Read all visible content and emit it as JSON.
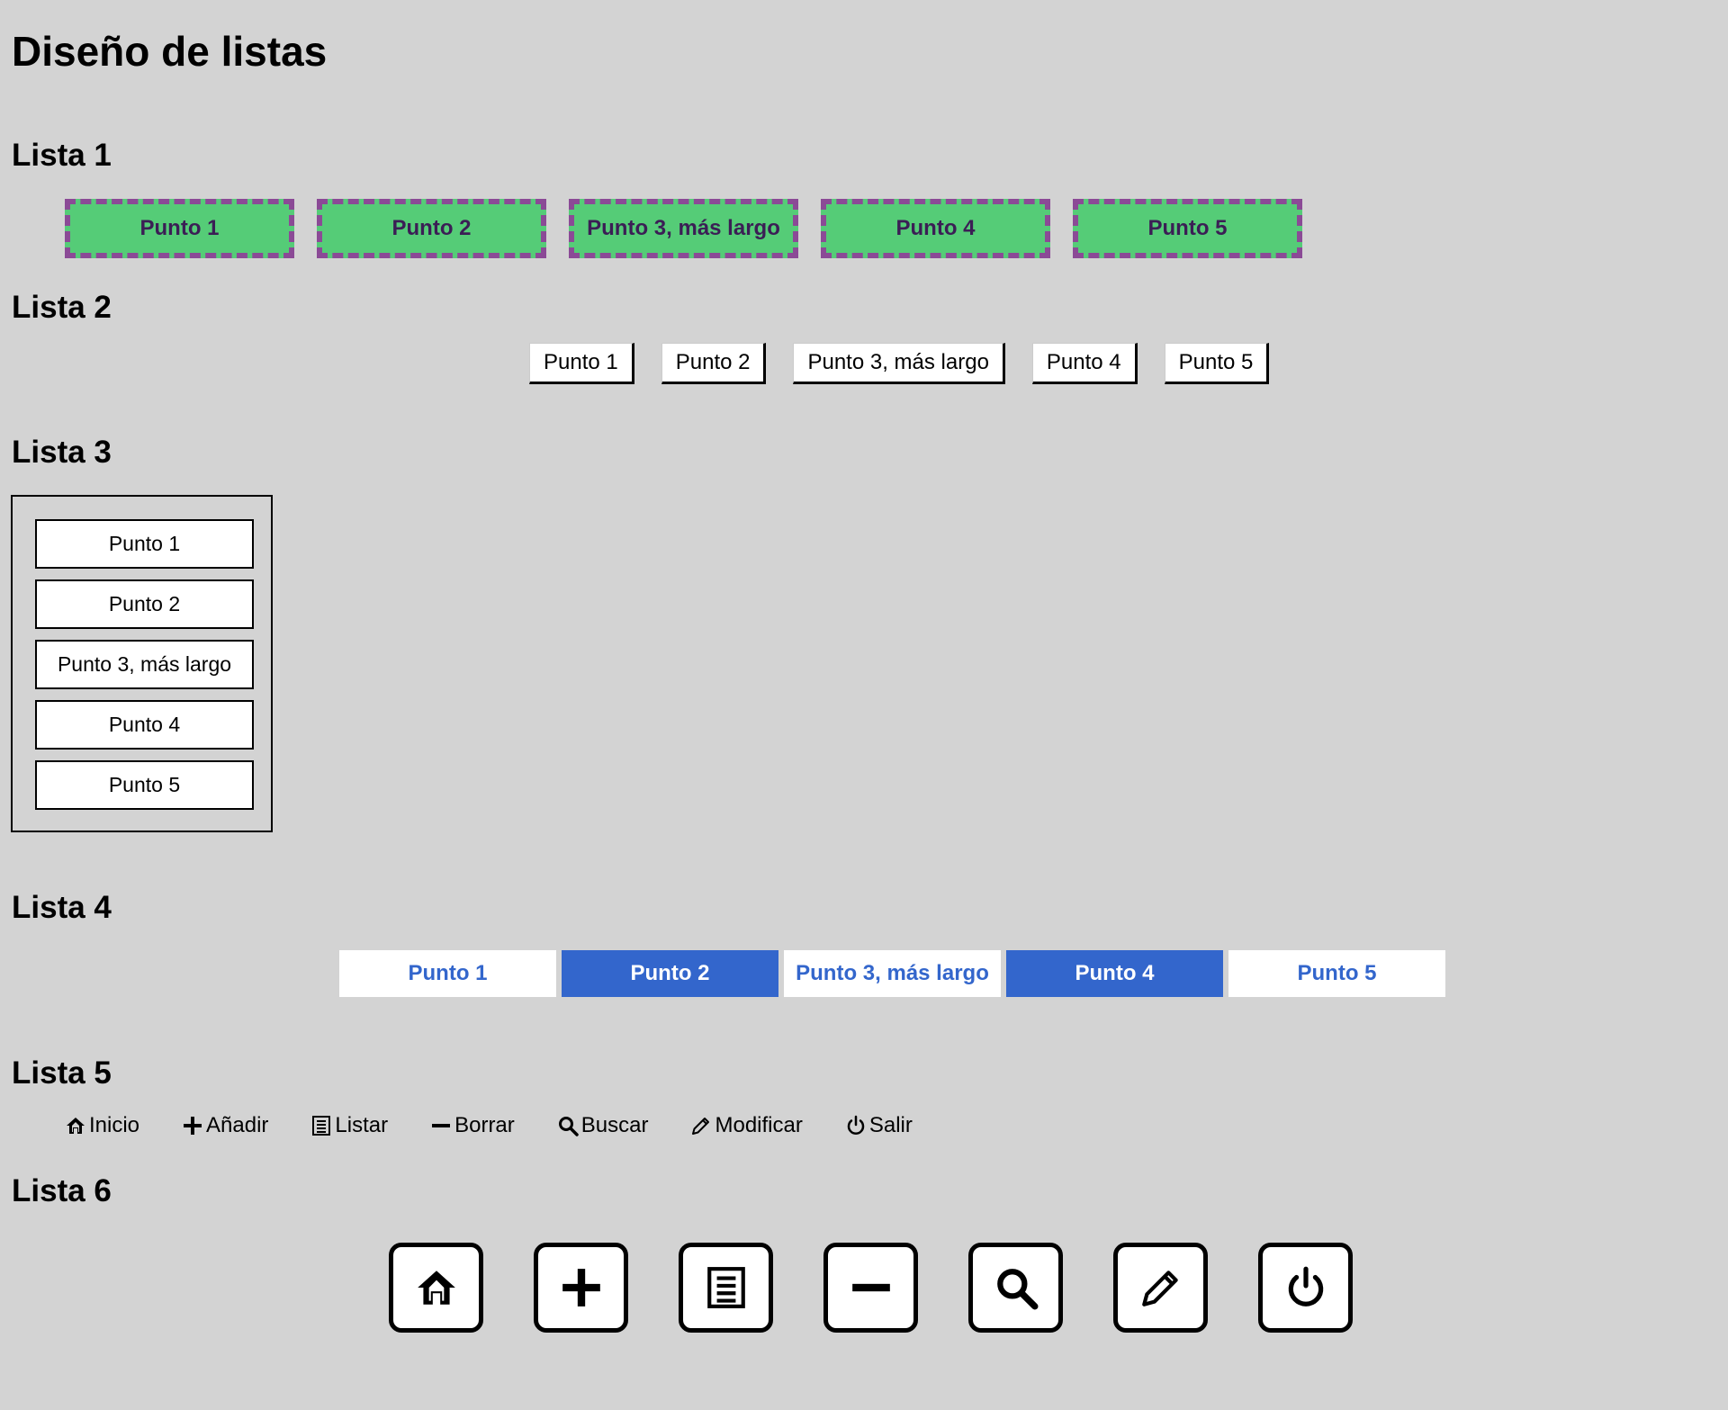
{
  "page_title": "Diseño de listas",
  "lista1": {
    "heading": "Lista 1",
    "items": [
      "Punto 1",
      "Punto 2",
      "Punto 3, más largo",
      "Punto 4",
      "Punto 5"
    ]
  },
  "lista2": {
    "heading": "Lista 2",
    "items": [
      "Punto 1",
      "Punto 2",
      "Punto 3, más largo",
      "Punto 4",
      "Punto 5"
    ]
  },
  "lista3": {
    "heading": "Lista 3",
    "items": [
      "Punto 1",
      "Punto 2",
      "Punto 3, más largo",
      "Punto 4",
      "Punto 5"
    ]
  },
  "lista4": {
    "heading": "Lista 4",
    "items": [
      "Punto 1",
      "Punto 2",
      "Punto 3, más largo",
      "Punto 4",
      "Punto 5"
    ],
    "accent": "#3366cc"
  },
  "lista5": {
    "heading": "Lista 5",
    "items": [
      {
        "label": "Inicio",
        "icon": "home-icon"
      },
      {
        "label": "Añadir",
        "icon": "plus-icon"
      },
      {
        "label": "Listar",
        "icon": "list-icon"
      },
      {
        "label": "Borrar",
        "icon": "minus-icon"
      },
      {
        "label": "Buscar",
        "icon": "search-icon"
      },
      {
        "label": "Modificar",
        "icon": "pencil-icon"
      },
      {
        "label": "Salir",
        "icon": "power-icon"
      }
    ]
  },
  "lista6": {
    "heading": "Lista 6",
    "icons": [
      "home-icon",
      "plus-icon",
      "list-icon",
      "minus-icon",
      "search-icon",
      "pencil-icon",
      "power-icon"
    ]
  },
  "colors": {
    "background": "#d3d3d3",
    "lista1_fill": "#55cc77",
    "lista1_border": "#8b4a96"
  }
}
